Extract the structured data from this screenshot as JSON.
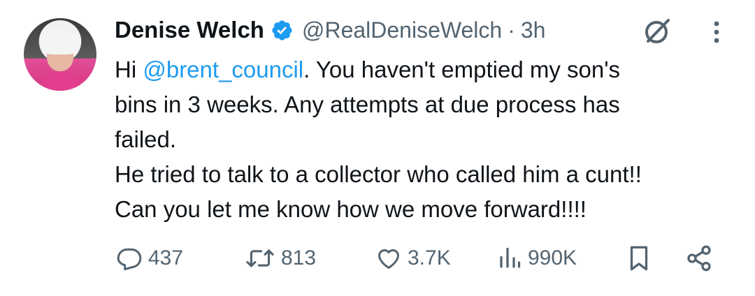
{
  "tweet": {
    "author": {
      "name": "Denise Welch",
      "handle": "@RealDeniseWelch",
      "verified": true
    },
    "separator": "·",
    "time": "3h",
    "text": {
      "lines": [
        {
          "prefix": "Hi ",
          "mention": "@brent_council",
          "rest": ". You haven't emptied my son's"
        },
        {
          "text": "bins in 3 weeks. Any attempts at due process has"
        },
        {
          "text": "failed."
        },
        {
          "text": "He tried to talk to a collector who called him a cunt!!"
        },
        {
          "text": "Can you let me know how we move forward!!!!"
        }
      ]
    },
    "stats": {
      "replies": "437",
      "reposts": "813",
      "likes": "3.7K",
      "views": "990K"
    }
  },
  "icons": {
    "verified": "verified-badge-icon",
    "grok": "grok-icon",
    "more": "more-vertical-icon",
    "reply": "reply-icon",
    "repost": "repost-icon",
    "like": "heart-icon",
    "views": "views-icon",
    "bookmark": "bookmark-icon",
    "share": "share-icon"
  },
  "colors": {
    "text": "#0f1419",
    "secondary": "#536471",
    "link": "#1d9bf0",
    "verified": "#1d9bf0"
  }
}
